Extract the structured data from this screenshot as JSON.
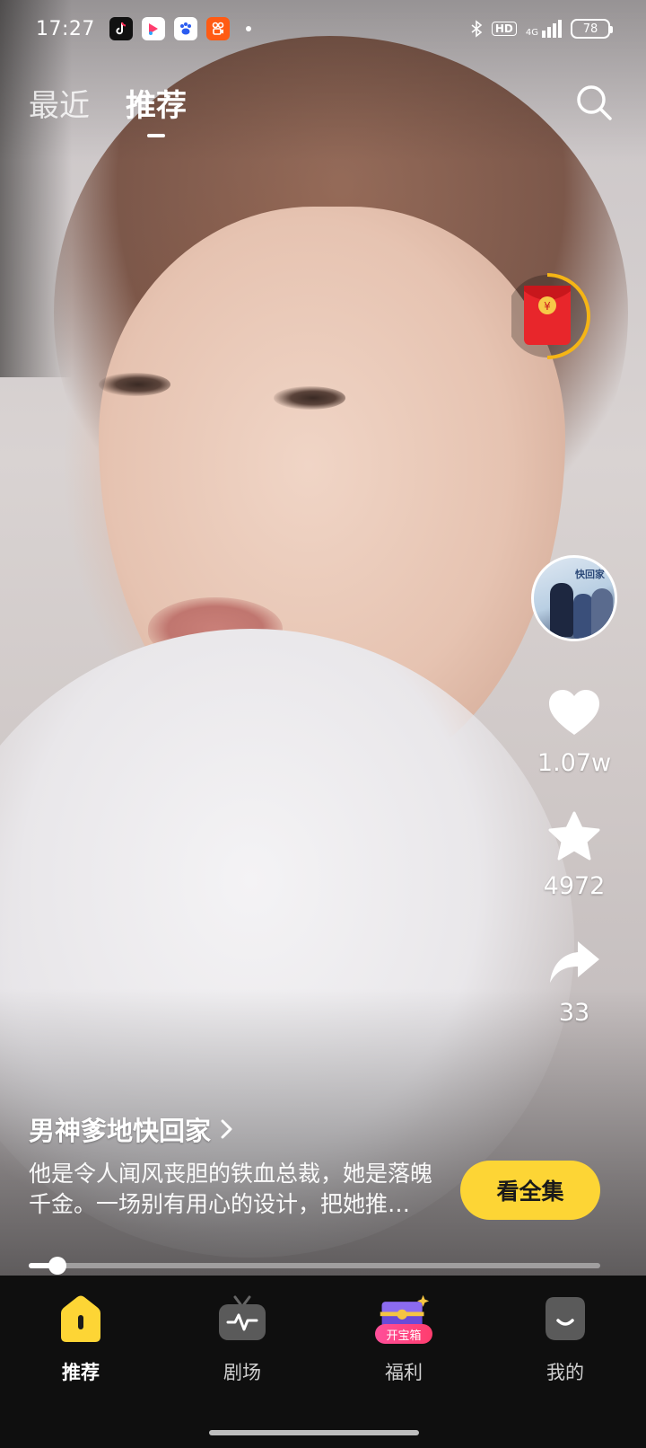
{
  "status_bar": {
    "time": "17:27",
    "battery": "78",
    "network": "4G",
    "hd_label": "HD"
  },
  "top_tabs": [
    {
      "label": "最近",
      "active": false
    },
    {
      "label": "推荐",
      "active": true
    }
  ],
  "side_actions": {
    "like_count": "1.07w",
    "favorite_count": "4972",
    "share_count": "33",
    "poster_title": "快回家"
  },
  "drama": {
    "title": "男神爹地快回家",
    "description": "他是令人闻风丧胆的铁血总裁，她是落魄千金。一场别有用心的设计，把她推向了他……",
    "watch_button": "看全集",
    "progress": 0.05
  },
  "bottom_nav": {
    "items": [
      {
        "label": "推荐",
        "icon": "home-icon",
        "active": true
      },
      {
        "label": "剧场",
        "icon": "tv-icon",
        "active": false
      },
      {
        "label": "福利",
        "icon": "treasure-chest-icon",
        "active": false,
        "badge": "开宝箱"
      },
      {
        "label": "我的",
        "icon": "profile-icon",
        "active": false
      }
    ]
  },
  "colors": {
    "accent_yellow": "#fdd535",
    "nav_background": "#0f0f0f",
    "red_packet": "#e8262b"
  }
}
